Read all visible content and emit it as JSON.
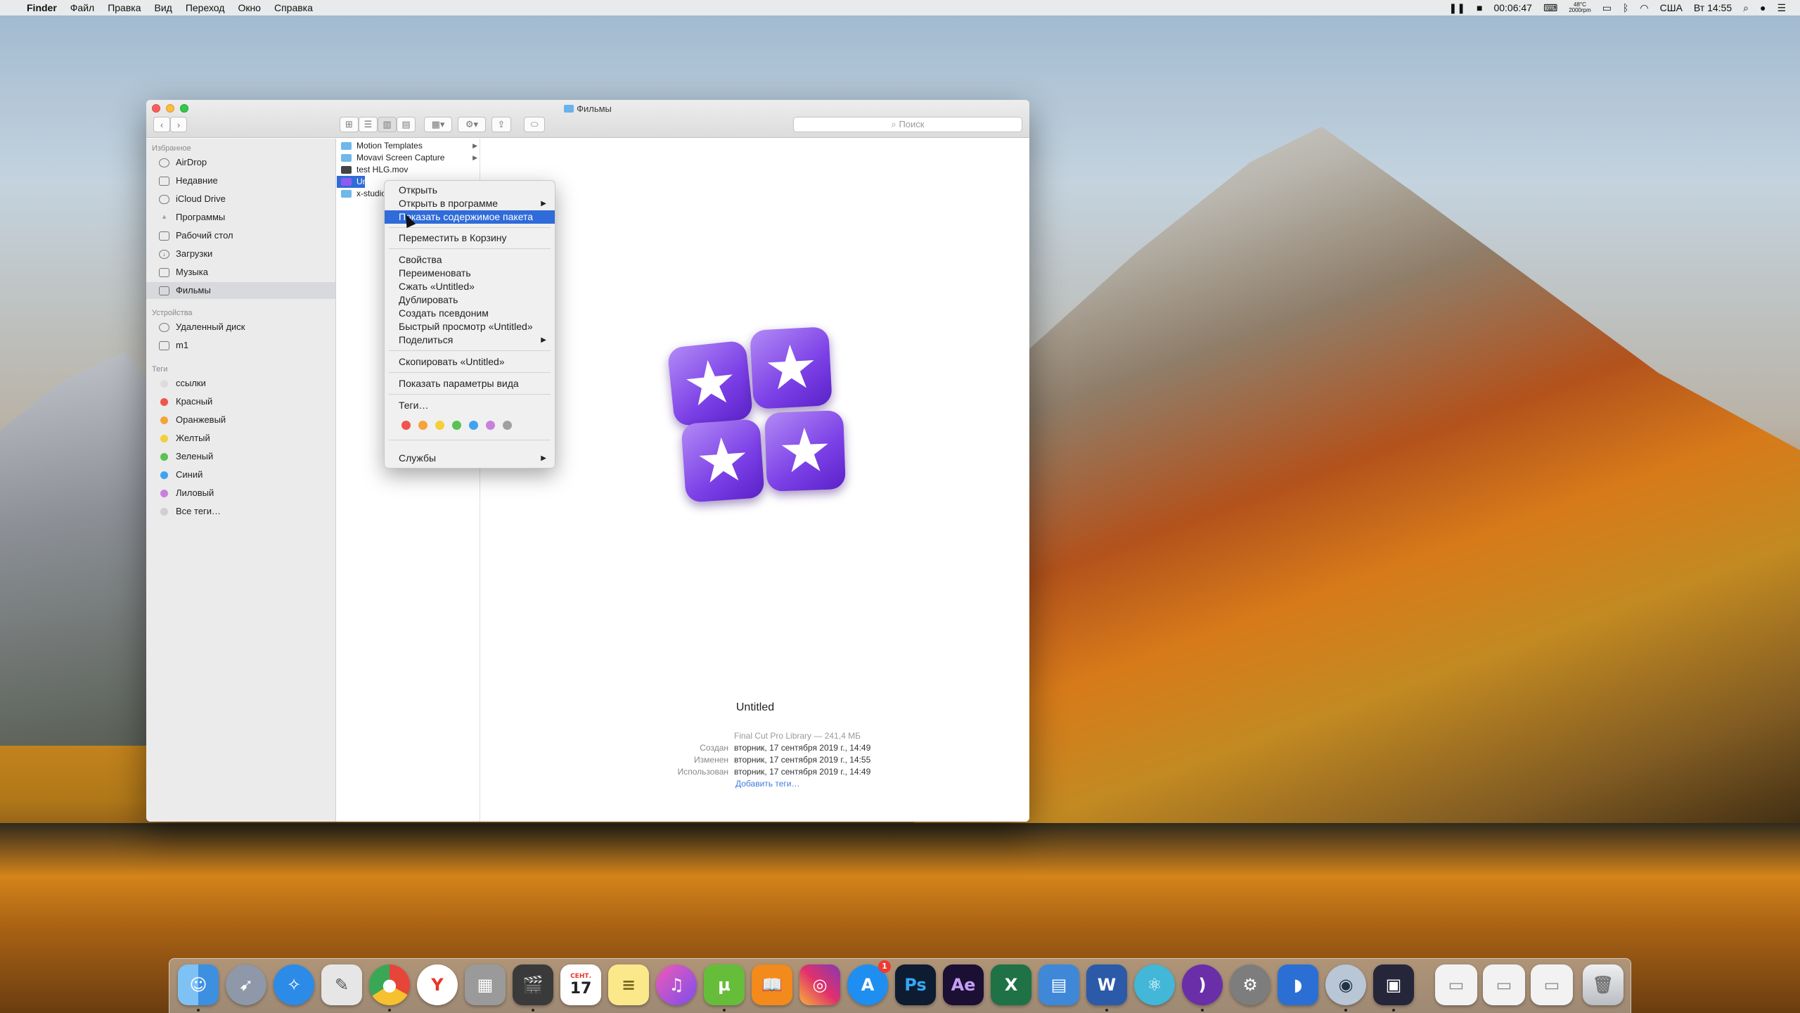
{
  "menubar": {
    "apple": "",
    "app_name": "Finder",
    "items": [
      "Файл",
      "Правка",
      "Вид",
      "Переход",
      "Окно",
      "Справка"
    ],
    "status": {
      "time_recording": "00:06:47",
      "temp": "48°C",
      "rpm": "2000rpm",
      "input_source": "США",
      "clock": "Вт 14:55"
    }
  },
  "window": {
    "title": "Фильмы",
    "search_placeholder": "Поиск"
  },
  "sidebar": {
    "favorites_heading": "Избранное",
    "favorites": [
      "AirDrop",
      "Недавние",
      "iCloud Drive",
      "Программы",
      "Рабочий стол",
      "Загрузки",
      "Музыка",
      "Фильмы"
    ],
    "devices_heading": "Устройства",
    "devices": [
      "Удаленный диск",
      "m1"
    ],
    "tags_heading": "Теги",
    "tags": [
      {
        "name": "ссылки",
        "color": "#dcdcdc"
      },
      {
        "name": "Красный",
        "color": "#f0544c"
      },
      {
        "name": "Оранжевый",
        "color": "#f5a33a"
      },
      {
        "name": "Желтый",
        "color": "#f4cf3a"
      },
      {
        "name": "Зеленый",
        "color": "#5ac252"
      },
      {
        "name": "Синий",
        "color": "#3fa3ef"
      },
      {
        "name": "Лиловый",
        "color": "#c780dc"
      },
      {
        "name": "Все теги…",
        "color": "#d0d0d0"
      }
    ]
  },
  "files": [
    "Motion Templates",
    "Movavi Screen Capture",
    "test HLG.mov",
    "Untitled",
    "x-studio"
  ],
  "context_menu": {
    "open": "Открыть",
    "open_with": "Открыть в программе",
    "show_package": "Показать содержимое пакета",
    "move_trash": "Переместить в Корзину",
    "get_info": "Свойства",
    "rename": "Переименовать",
    "compress": "Сжать «Untitled»",
    "duplicate": "Дублировать",
    "make_alias": "Создать псевдоним",
    "quick_look": "Быстрый просмотр «Untitled»",
    "share": "Поделиться",
    "copy": "Скопировать «Untitled»",
    "view_options": "Показать параметры вида",
    "tags": "Теги…",
    "tag_colors": [
      "#f0544c",
      "#f5a33a",
      "#f4cf3a",
      "#5ac252",
      "#3fa3ef",
      "#c780dc",
      "#a0a0a0"
    ],
    "services": "Службы"
  },
  "preview": {
    "name": "Untitled",
    "kind": "Final Cut Pro Library — 241,4 МБ",
    "created_label": "Создан",
    "created": "вторник, 17 сентября 2019 г., 14:49",
    "modified_label": "Изменен",
    "modified": "вторник, 17 сентября 2019 г., 14:55",
    "used_label": "Использован",
    "used": "вторник, 17 сентября 2019 г., 14:49",
    "add_tags": "Добавить теги…"
  },
  "dock": {
    "calendar_month": "СЕНТ.",
    "calendar_day": "17",
    "appstore_badge": "1",
    "ps_label": "Ps",
    "ae_label": "Ae",
    "excel_label": "X",
    "word_label": "W",
    "yandex_label": "Y"
  }
}
